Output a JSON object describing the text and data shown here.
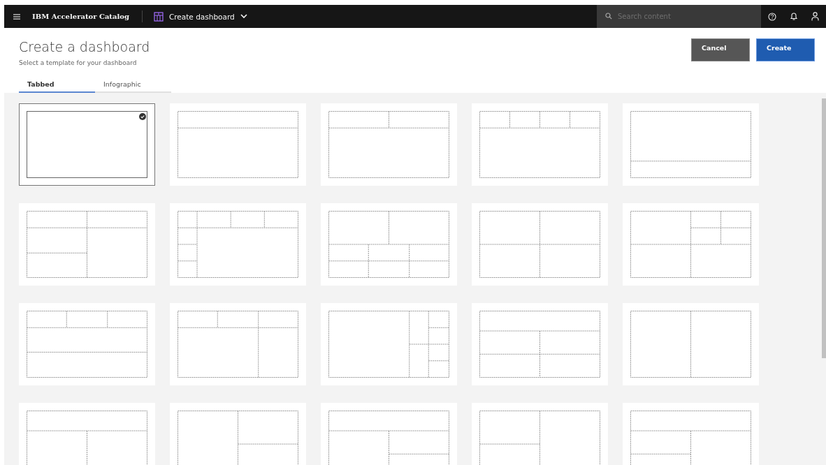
{
  "topbar": {
    "app_name": "IBM Accelerator Catalog",
    "page_menu": "Create dashboard",
    "search": {
      "placeholder": "Search content"
    }
  },
  "header": {
    "title": "Create a dashboard",
    "subtitle": "Select a template for your dashboard"
  },
  "buttons": [
    {
      "label": "Cancel",
      "kind": "secondary"
    },
    {
      "label": "Create",
      "kind": "primary"
    }
  ],
  "tabs": [
    {
      "label": "Tabbed",
      "selected": true
    },
    {
      "label": "Infographic",
      "selected": false
    }
  ],
  "templates": [
    {
      "kind": "blank",
      "selected": true
    },
    {
      "kind": "banner",
      "selected": false
    },
    {
      "kind": "banner2",
      "selected": false
    },
    {
      "kind": "banner4",
      "selected": false
    },
    {
      "kind": "footer",
      "selected": false
    },
    {
      "kind": "halves",
      "selected": false
    },
    {
      "kind": "sidebar",
      "selected": false
    },
    {
      "kind": "mosaic",
      "selected": false
    },
    {
      "kind": "quad",
      "selected": false
    },
    {
      "kind": "corner",
      "selected": false
    },
    {
      "kind": "stack",
      "selected": false
    },
    {
      "kind": "column",
      "selected": false
    },
    {
      "kind": "rail",
      "selected": false
    },
    {
      "kind": "grid",
      "selected": false
    },
    {
      "kind": "split",
      "selected": false
    },
    {
      "kind": "tee",
      "selected": false
    },
    {
      "kind": "rightsplit",
      "selected": false
    },
    {
      "kind": "teeright",
      "selected": false
    },
    {
      "kind": "leftsplit",
      "selected": false
    },
    {
      "kind": "teeleft",
      "selected": false
    }
  ]
}
